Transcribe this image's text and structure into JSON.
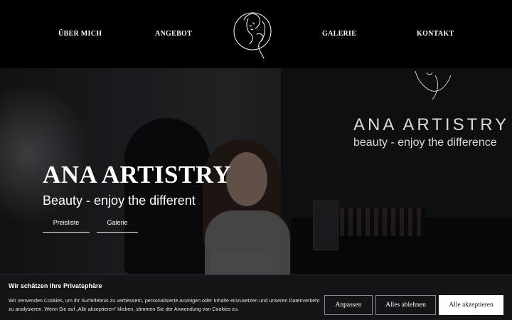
{
  "header": {
    "nav": [
      "ÜBER MICH",
      "ANGEBOT",
      "GALERIE",
      "KONTAKT"
    ],
    "logo_icon": "line-art-face-logo"
  },
  "hero": {
    "title": "ANA ARTISTRY",
    "subtitle": "Beauty - enjoy the different",
    "buttons": [
      "Preisliste",
      "Galerie"
    ],
    "wall_sign": {
      "brand": "ANA ARTISTRY",
      "tagline": "beauty - enjoy the difference"
    }
  },
  "cookie_banner": {
    "title": "Wir schätzen Ihre Privatsphäre",
    "text": "Wir verwenden Cookies, um Ihr Surferlebnis zu verbessern, personalisierte Anzeigen oder Inhalte einzusetzen und unseren Datenverkehr zu analysieren. Wenn Sie auf „Alle akzeptieren“ klicken, stimmen Sie der Anwendung von Cookies zu.",
    "customize_label": "Anpassen",
    "reject_label": "Alles ablehnen",
    "accept_label": "Alle akzeptieren"
  },
  "colors": {
    "background": "#000000",
    "banner": "#141517",
    "text": "#ffffff"
  }
}
